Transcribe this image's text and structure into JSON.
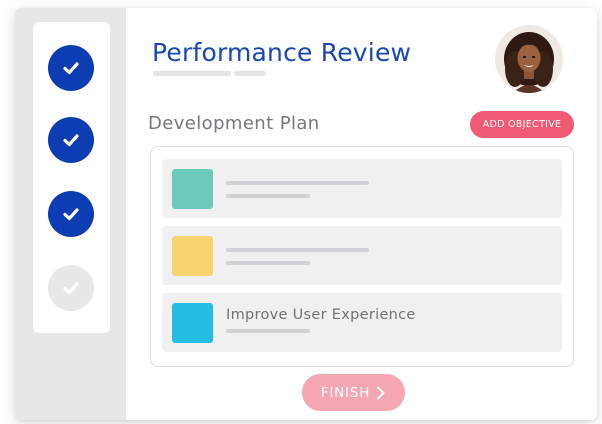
{
  "header": {
    "title": "Performance Review"
  },
  "steps": [
    {
      "status": "completed",
      "icon": "check-icon"
    },
    {
      "status": "completed",
      "icon": "check-icon"
    },
    {
      "status": "completed",
      "icon": "check-icon"
    },
    {
      "status": "incomplete",
      "icon": "check-icon"
    }
  ],
  "development_plan": {
    "title": "Development Plan",
    "add_button_label": "ADD OBJECTIVE",
    "objectives": [
      {
        "label": "",
        "color": "#6dc9b9"
      },
      {
        "label": "",
        "color": "#f6d36e"
      },
      {
        "label": "Improve User Experience",
        "color": "#27bde3"
      }
    ]
  },
  "finish_button_label": "FINISH",
  "colors": {
    "primary": "#0d3db3",
    "title": "#1846b3",
    "accent": "#f05a72",
    "accent_muted": "#f6a6b3",
    "sidebar": "#e6e7e9"
  }
}
